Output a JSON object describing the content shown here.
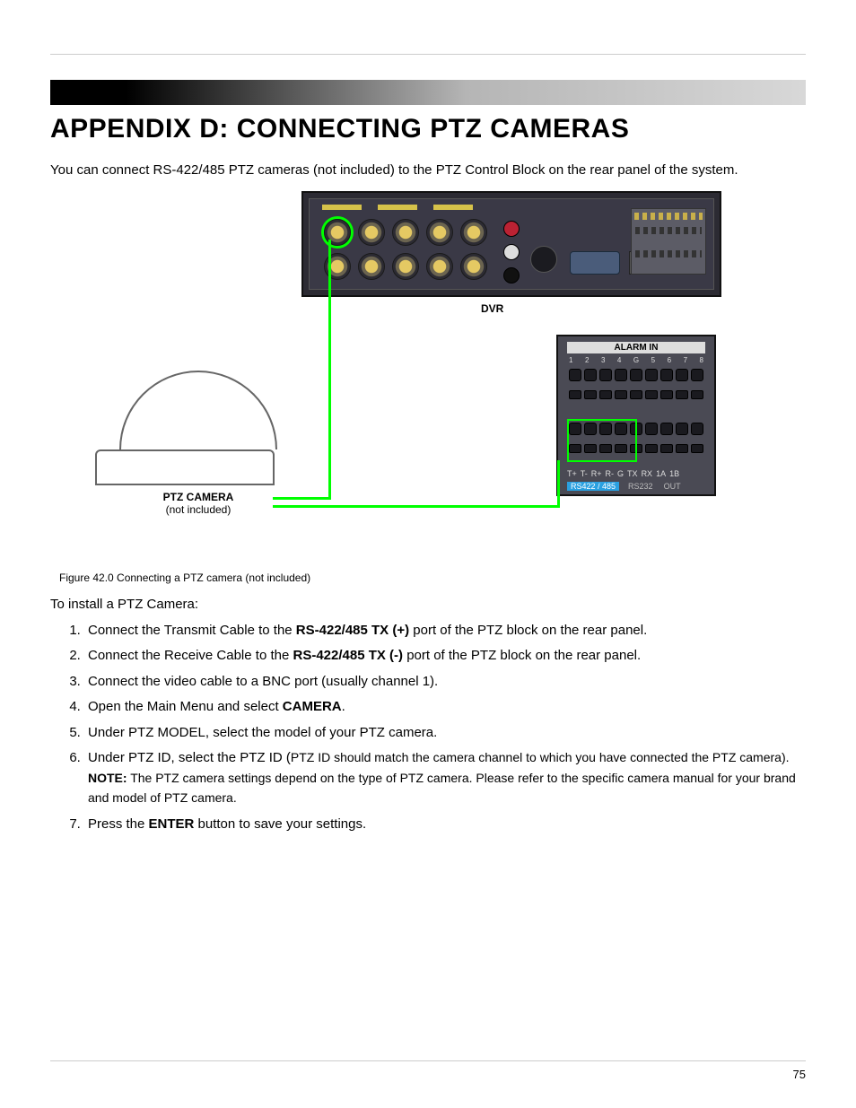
{
  "heading": "APPENDIX D: CONNECTING PTZ CAMERAS",
  "intro": "You can connect RS-422/485 PTZ cameras (not included) to the PTZ Control Block on the rear panel of the system.",
  "figure": {
    "dvr_label": "DVR",
    "alarm_title": "ALARM IN",
    "alarm_nums": [
      "1",
      "2",
      "3",
      "4",
      "G",
      "5",
      "6",
      "7",
      "8"
    ],
    "alarm_pins": [
      "T+",
      "T-",
      "R+",
      "R-",
      "G",
      "TX",
      "RX",
      "1A",
      "1B"
    ],
    "alarm_bottom": [
      "RS422 / 485",
      "RS232",
      "OUT"
    ],
    "ptz_label": "PTZ CAMERA",
    "ptz_sub": "(not included)",
    "caption": "Figure 42.0 Connecting a PTZ camera (not included)"
  },
  "instr_lead": "To install a PTZ Camera:",
  "steps": {
    "s1a": "Connect the Transmit Cable to the ",
    "s1b": "RS-422/485 TX (+)",
    "s1c": " port of the PTZ block on the rear panel.",
    "s2a": "Connect the Receive Cable to the ",
    "s2b": "RS-422/485 TX (-)",
    "s2c": " port of the PTZ block on the rear panel.",
    "s3": "Connect the video cable to a BNC port (usually channel 1).",
    "s4a": "Open the Main Menu and select ",
    "s4b": "CAMERA",
    "s4c": ".",
    "s5": "Under PTZ MODEL, select the model of your PTZ camera.",
    "s6a": "Under PTZ ID, select the PTZ ID (",
    "s6b": "PTZ ID should match the camera channel to which you have connected the PTZ camera).",
    "s6note_label": "NOTE:",
    "s6note": " The PTZ camera settings depend on the type of PTZ camera. Please refer to the specific camera manual for your brand and model of PTZ camera.",
    "s7a": "Press the ",
    "s7b": "ENTER",
    "s7c": " button to save your settings."
  },
  "page_number": "75"
}
